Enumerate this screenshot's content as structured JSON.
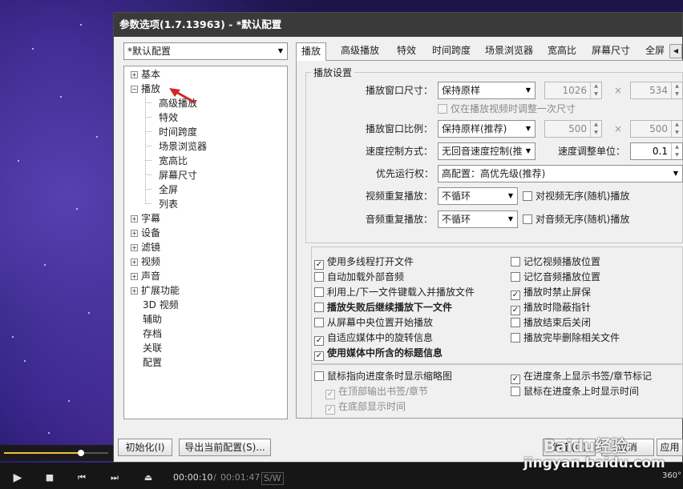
{
  "window": {
    "title": "参数选项(1.7.13963) - *默认配置"
  },
  "profile_select": {
    "value": "*默认配置"
  },
  "tree": {
    "items": [
      {
        "label": "基本",
        "expander": "+"
      },
      {
        "label": "播放",
        "expander": "−"
      },
      {
        "label": "高级播放"
      },
      {
        "label": "特效"
      },
      {
        "label": "时间跨度"
      },
      {
        "label": "场景浏览器"
      },
      {
        "label": "宽高比"
      },
      {
        "label": "屏幕尺寸"
      },
      {
        "label": "全屏"
      },
      {
        "label": "列表"
      },
      {
        "label": "字幕",
        "expander": "+"
      },
      {
        "label": "设备",
        "expander": "+"
      },
      {
        "label": "滤镜",
        "expander": "+"
      },
      {
        "label": "视频",
        "expander": "+"
      },
      {
        "label": "声音",
        "expander": "+"
      },
      {
        "label": "扩展功能",
        "expander": "+"
      },
      {
        "label": "3D 视频"
      },
      {
        "label": "辅助"
      },
      {
        "label": "存档"
      },
      {
        "label": "关联"
      },
      {
        "label": "配置"
      }
    ]
  },
  "tabs": [
    "播放",
    "高级播放",
    "特效",
    "时间跨度",
    "场景浏览器",
    "宽高比",
    "屏幕尺寸",
    "全屏"
  ],
  "active_tab": "播放",
  "playback_settings": {
    "group_title": "播放设置",
    "window_size": {
      "label": "播放窗口尺寸：",
      "value": "保持原样",
      "width": "1026",
      "height": "534",
      "times": "×"
    },
    "adjust_once": {
      "label": "仅在播放视频时调整一次尺寸",
      "checked": false
    },
    "window_ratio": {
      "label": "播放窗口比例：",
      "value": "保持原样(推荐)",
      "width": "500",
      "height": "500",
      "times": "×"
    },
    "speed_mode": {
      "label": "速度控制方式：",
      "value": "无回音速度控制(推"
    },
    "speed_unit": {
      "label": "速度调整单位：",
      "value": "0.1"
    },
    "priority": {
      "label": "优先运行权：",
      "value": "高配置：高优先级(推荐)"
    },
    "video_repeat": {
      "label": "视频重复播放：",
      "value": "不循环",
      "random_label": "对视频无序(随机)播放"
    },
    "audio_repeat": {
      "label": "音频重复播放：",
      "value": "不循环",
      "random_label": "对音频无序(随机)播放"
    }
  },
  "options_left": [
    {
      "label": "使用多线程打开文件",
      "checked": "✓"
    },
    {
      "label": "自动加载外部音频",
      "checked": ""
    },
    {
      "label": "利用上/下一文件键载入并播放文件",
      "checked": ""
    },
    {
      "label": "播放失败后继续播放下一文件",
      "checked": ""
    },
    {
      "label": "从屏幕中央位置开始播放",
      "checked": ""
    },
    {
      "label": "自适应媒体中的旋转信息",
      "checked": "✓"
    },
    {
      "label": "使用媒体中所含的标题信息",
      "checked": "✓"
    }
  ],
  "options_right": [
    {
      "label": "记忆视频播放位置",
      "checked": ""
    },
    {
      "label": "记忆音频播放位置",
      "checked": ""
    },
    {
      "label": "播放时禁止屏保",
      "checked": "✓"
    },
    {
      "label": "播放时隐蔽指针",
      "checked": "✓"
    },
    {
      "label": "播放结束后关闭",
      "checked": ""
    },
    {
      "label": "播放完毕删除相关文件",
      "checked": ""
    }
  ],
  "progress_options": {
    "thumbnail": {
      "label": "鼠标指向进度条时显示缩略图",
      "checked": ""
    },
    "top_bookmark": {
      "label": "在顶部输出书签/章节",
      "checked": "✓"
    },
    "bottom_time": {
      "label": "在底部显示时间",
      "checked": "✓"
    },
    "show_bookmarks": {
      "label": "在进度条上显示书签/章节标记",
      "checked": "✓"
    },
    "mouse_time": {
      "label": "鼠标在进度条上时显示时间",
      "checked": ""
    }
  },
  "buttons": {
    "init": "初始化(I)",
    "export": "导出当前配置(S)...",
    "ok": "确定(O)",
    "cancel": "取消",
    "apply": "应用"
  },
  "player": {
    "current_time": "00:00:10",
    "separator": "/",
    "total_time": "00:01:47",
    "sw": "S/W",
    "seek_fraction": 0.74,
    "badge": "360°"
  },
  "watermark": {
    "text": "jingyan.baidu.com",
    "brand": "Baidu经验"
  }
}
